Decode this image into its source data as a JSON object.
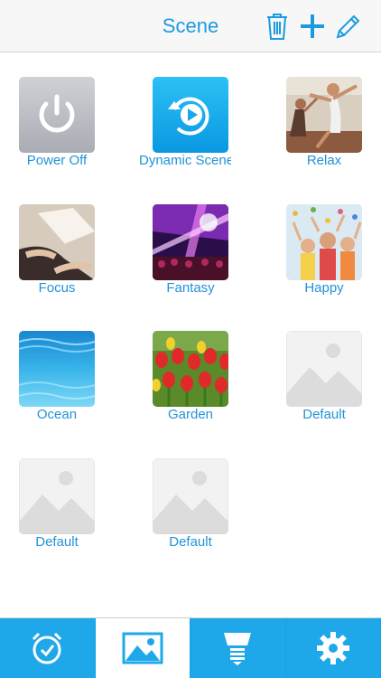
{
  "header": {
    "title": "Scene",
    "icons": [
      "trash-icon",
      "plus-icon",
      "pencil-icon"
    ]
  },
  "scenes": [
    {
      "label": "Power Off",
      "image": "power-icon"
    },
    {
      "label": "Dynamic Scene",
      "image": "dynamic-scene-icon"
    },
    {
      "label": "Relax",
      "image": "yoga-photo"
    },
    {
      "label": "Focus",
      "image": "book-photo"
    },
    {
      "label": "Fantasy",
      "image": "concert-lights-photo"
    },
    {
      "label": "Happy",
      "image": "children-photo"
    },
    {
      "label": "Ocean",
      "image": "ocean-photo"
    },
    {
      "label": "Garden",
      "image": "tulips-photo"
    },
    {
      "label": "Default",
      "image": "image-placeholder-icon"
    },
    {
      "label": "Default",
      "image": "image-placeholder-icon"
    },
    {
      "label": "Default",
      "image": "image-placeholder-icon"
    }
  ],
  "tabs": [
    {
      "icon": "alarm-clock-icon",
      "active": false
    },
    {
      "icon": "picture-icon",
      "active": true
    },
    {
      "icon": "bulb-icon",
      "active": false
    },
    {
      "icon": "gear-icon",
      "active": false
    }
  ],
  "colors": {
    "accent": "#1a9be0",
    "tabbar": "#1ea8ea",
    "label": "#2293d6"
  }
}
